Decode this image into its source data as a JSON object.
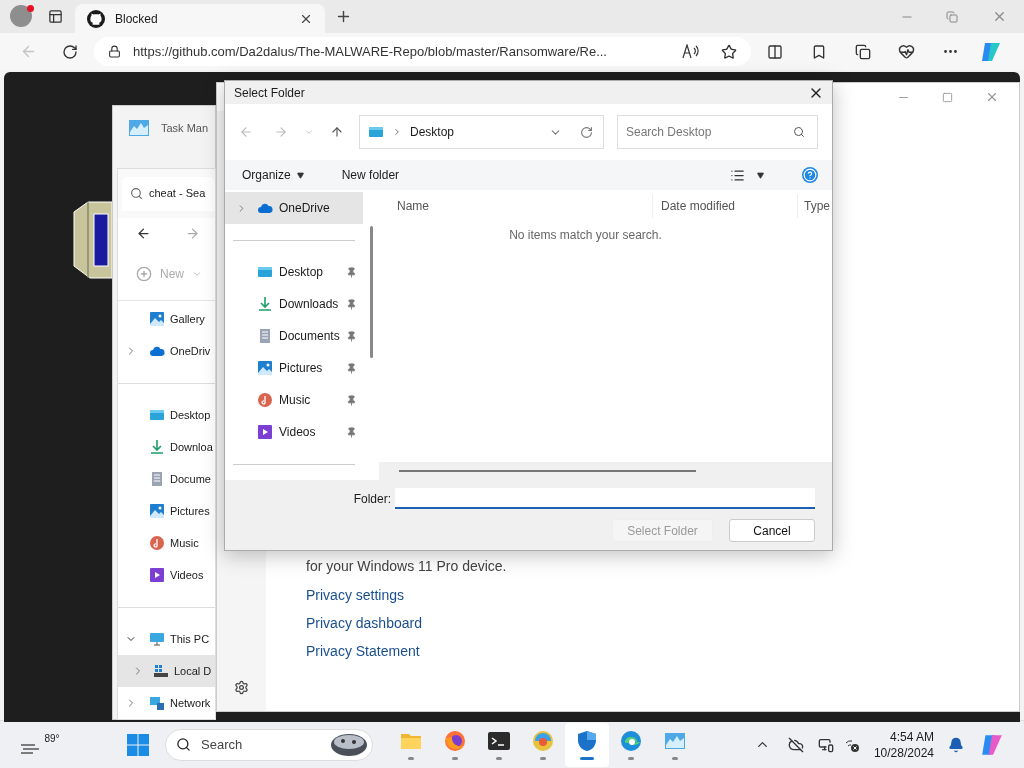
{
  "browser": {
    "tab": {
      "title": "Blocked",
      "selected": true
    },
    "url": "https://github.com/Da2dalus/The-MALWARE-Repo/blob/master/Ransomware/Re..."
  },
  "task_manager": {
    "title": "Task Man"
  },
  "explorer": {
    "tab": "cheat - Sea",
    "new_button": "New",
    "nav_items": [
      {
        "kind": "gallery",
        "label": "Gallery",
        "selected": false
      },
      {
        "kind": "cloud",
        "label": "OneDriv",
        "expanded": false,
        "selected": false
      },
      {
        "kind": "divider"
      },
      {
        "kind": "desktop",
        "label": "Desktop",
        "selected": false
      },
      {
        "kind": "download",
        "label": "Downloa",
        "selected": false
      },
      {
        "kind": "document",
        "label": "Docume",
        "selected": false
      },
      {
        "kind": "picture",
        "label": "Pictures",
        "selected": false
      },
      {
        "kind": "music",
        "label": "Music",
        "selected": false
      },
      {
        "kind": "video",
        "label": "Videos",
        "selected": false
      },
      {
        "kind": "divider"
      },
      {
        "kind": "pc",
        "label": "This PC",
        "expanded": true,
        "selected": false
      },
      {
        "kind": "drive",
        "label": "Local D",
        "expanded": false,
        "selected": true
      },
      {
        "kind": "network",
        "label": "Network",
        "expanded": false,
        "selected": false
      }
    ]
  },
  "settings": {
    "text": "for your Windows 11 Pro device.",
    "links": [
      "Privacy settings",
      "Privacy dashboard",
      "Privacy Statement"
    ]
  },
  "dialog": {
    "title": "Select Folder",
    "breadcrumb": "Desktop",
    "search_placeholder": "Search Desktop",
    "toolbar": [
      {
        "label": "Organize",
        "menu": true
      },
      {
        "label": "New folder",
        "menu": false
      }
    ],
    "nav_items": [
      {
        "kind": "cloud",
        "label": "OneDrive",
        "selected": true,
        "expanded": false,
        "pinned": false
      },
      {
        "kind": "divider"
      },
      {
        "kind": "desktop",
        "label": "Desktop",
        "selected": false,
        "pinned": true
      },
      {
        "kind": "download",
        "label": "Downloads",
        "selected": false,
        "pinned": true
      },
      {
        "kind": "document",
        "label": "Documents",
        "selected": false,
        "pinned": true
      },
      {
        "kind": "picture",
        "label": "Pictures",
        "selected": false,
        "pinned": true
      },
      {
        "kind": "music",
        "label": "Music",
        "selected": false,
        "pinned": true
      },
      {
        "kind": "video",
        "label": "Videos",
        "selected": false,
        "pinned": true
      },
      {
        "kind": "divider"
      }
    ],
    "columns": [
      "Name",
      "Date modified",
      "Type"
    ],
    "empty_message": "No items match your search.",
    "folder_label": "Folder:",
    "buttons": [
      {
        "label": "Select Folder",
        "disabled": true
      },
      {
        "label": "Cancel",
        "disabled": false
      }
    ]
  },
  "taskbar": {
    "weather": "89°",
    "search": "Search",
    "apps": [
      {
        "kind": "folder",
        "selected": false
      },
      {
        "kind": "firefox",
        "selected": false
      },
      {
        "kind": "terminal",
        "selected": false
      },
      {
        "kind": "swirl",
        "selected": false
      },
      {
        "kind": "shield",
        "selected": true
      },
      {
        "kind": "edge",
        "selected": false
      },
      {
        "kind": "monitor",
        "selected": false
      }
    ],
    "time": "4:54 AM",
    "date": "10/28/2024"
  }
}
